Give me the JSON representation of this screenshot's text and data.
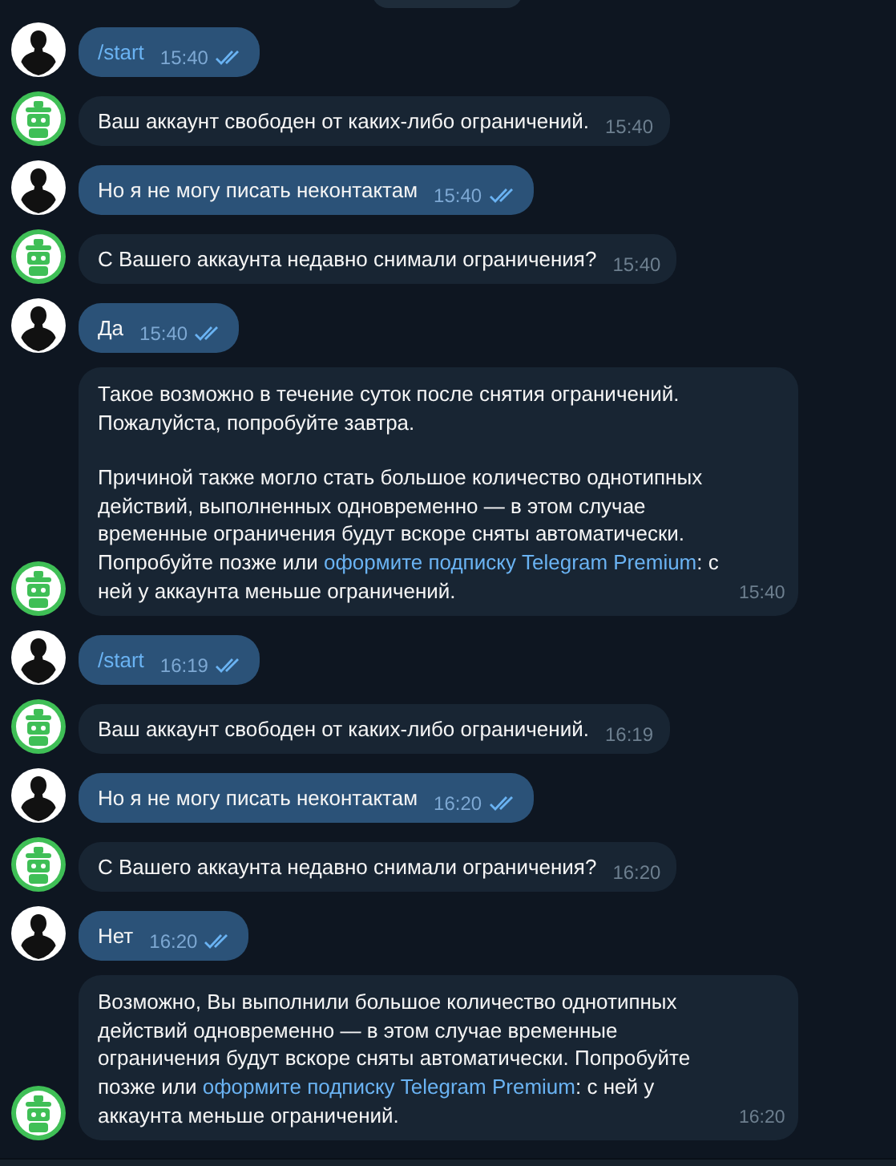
{
  "messages": [
    {
      "kind": "out",
      "paragraphs": [
        [
          {
            "kind": "command",
            "text": "/start"
          }
        ]
      ],
      "time": "15:40",
      "read": true
    },
    {
      "kind": "in",
      "paragraphs": [
        [
          {
            "kind": "plain",
            "text": "Ваш аккаунт свободен от каких-либо ограничений."
          }
        ]
      ],
      "time": "15:40"
    },
    {
      "kind": "out",
      "paragraphs": [
        [
          {
            "kind": "plain",
            "text": "Но я не могу писать неконтактам"
          }
        ]
      ],
      "time": "15:40",
      "read": true
    },
    {
      "kind": "in",
      "paragraphs": [
        [
          {
            "kind": "plain",
            "text": "С Вашего аккаунта недавно снимали ограничения?"
          }
        ]
      ],
      "time": "15:40"
    },
    {
      "kind": "out",
      "paragraphs": [
        [
          {
            "kind": "plain",
            "text": "Да"
          }
        ]
      ],
      "time": "15:40",
      "read": true
    },
    {
      "kind": "in",
      "paragraphs": [
        [
          {
            "kind": "plain",
            "text": "Такое возможно в течение суток после снятия ограничений. Пожалуйста, попробуйте завтра."
          }
        ],
        [
          {
            "kind": "plain",
            "text": "Причиной также могло стать большое количество однотипных действий, выполненных одновременно — в этом случае временные ограничения будут вскоре сняты автоматически. Попробуйте позже или "
          },
          {
            "kind": "link",
            "text": "оформите подписку Telegram Premium"
          },
          {
            "kind": "plain",
            "text": ": с ней у аккаунта меньше ограничений."
          }
        ]
      ],
      "time": "15:40"
    },
    {
      "kind": "out",
      "paragraphs": [
        [
          {
            "kind": "command",
            "text": "/start"
          }
        ]
      ],
      "time": "16:19",
      "read": true
    },
    {
      "kind": "in",
      "paragraphs": [
        [
          {
            "kind": "plain",
            "text": "Ваш аккаунт свободен от каких-либо ограничений."
          }
        ]
      ],
      "time": "16:19"
    },
    {
      "kind": "out",
      "paragraphs": [
        [
          {
            "kind": "plain",
            "text": "Но я не могу писать неконтактам"
          }
        ]
      ],
      "time": "16:20",
      "read": true
    },
    {
      "kind": "in",
      "paragraphs": [
        [
          {
            "kind": "plain",
            "text": "С Вашего аккаунта недавно снимали ограничения?"
          }
        ]
      ],
      "time": "16:20"
    },
    {
      "kind": "out",
      "paragraphs": [
        [
          {
            "kind": "plain",
            "text": "Нет"
          }
        ]
      ],
      "time": "16:20",
      "read": true
    },
    {
      "kind": "in",
      "paragraphs": [
        [
          {
            "kind": "plain",
            "text": "Возможно, Вы выполнили большое количество однотипных действий одновременно — в этом случае временные ограничения будут вскоре сняты автоматически. Попробуйте позже или "
          },
          {
            "kind": "link",
            "text": "оформите подписку Telegram Premium"
          },
          {
            "kind": "plain",
            "text": ": с ней у аккаунта меньше ограничений."
          }
        ]
      ],
      "time": "16:20"
    }
  ]
}
